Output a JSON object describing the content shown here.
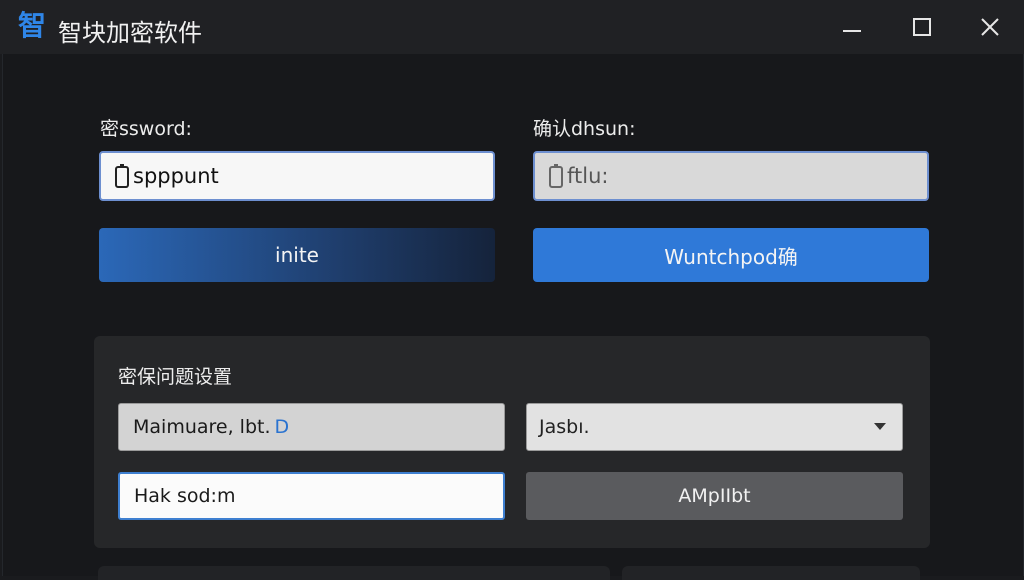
{
  "window": {
    "icon_char": "智",
    "title": "智块加密软件"
  },
  "password": {
    "label": "密ssword:",
    "value": "spppunt"
  },
  "confirm": {
    "label": "确认dhsun:",
    "value": "ftlu:"
  },
  "buttons": {
    "left": "inite",
    "right": "Wuntchpod确"
  },
  "security": {
    "title": "密保问题设置",
    "question_value": "Maimuare, lbt.",
    "question_accent": "D",
    "select_value": "Jasbı.",
    "answer_value": "Hak sod:m",
    "apply_label": "AMpIIbt"
  },
  "colors": {
    "accent": "#2f79d8",
    "background": "#17181b"
  },
  "icons": [
    "minimize-icon",
    "maximize-icon",
    "close-icon",
    "phone-icon",
    "chevron-down-icon"
  ]
}
